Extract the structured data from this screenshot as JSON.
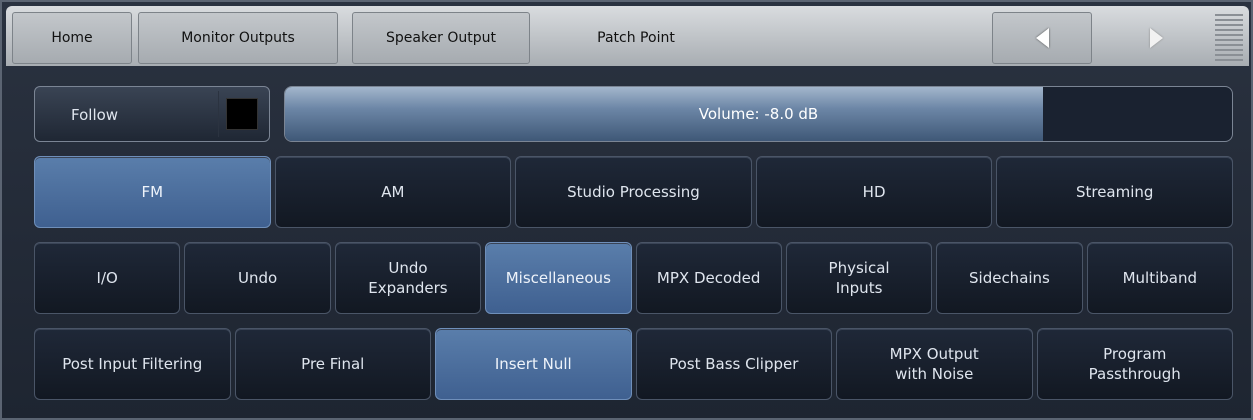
{
  "nav": {
    "tabs": [
      "Home",
      "Monitor Outputs",
      "Speaker Output",
      "Patch Point"
    ],
    "back_icon": "triangle-left",
    "forward_icon": "triangle-right",
    "menu_icon": "hamburger-lines"
  },
  "follow": {
    "label": "Follow",
    "checked": false
  },
  "volume": {
    "label": "Volume: -8.0 dB",
    "fill_fraction": 0.8
  },
  "row_outputs": {
    "items": [
      "FM",
      "AM",
      "Studio Processing",
      "HD",
      "Streaming"
    ],
    "selected": "FM"
  },
  "row_categories": {
    "items": [
      "I/O",
      "Undo",
      "Undo\nExpanders",
      "Miscellaneous",
      "MPX Decoded",
      "Physical\nInputs",
      "Sidechains",
      "Multiband"
    ],
    "selected": "Miscellaneous"
  },
  "row_points": {
    "items": [
      "Post Input Filtering",
      "Pre Final",
      "Insert Null",
      "Post Bass Clipper",
      "MPX Output\nwith Noise",
      "Program\nPassthrough"
    ],
    "selected": "Insert Null"
  },
  "colors": {
    "selected": "#4a6c9b",
    "panel": "#1e2531",
    "accent_bar": "#b9bec3"
  }
}
